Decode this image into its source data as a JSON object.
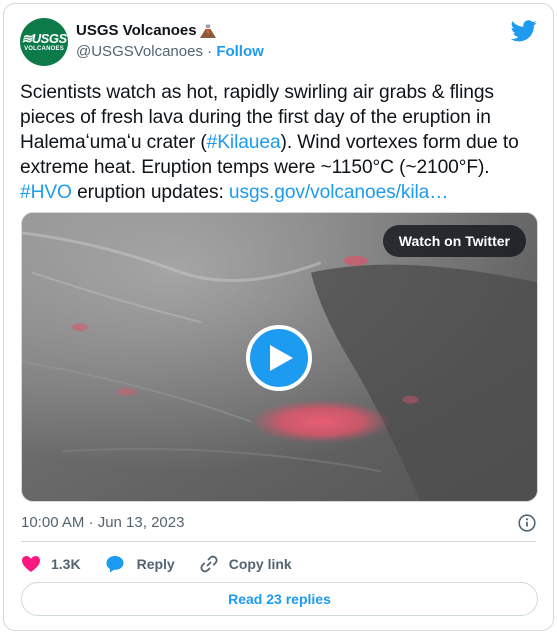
{
  "header": {
    "display_name": "USGS Volcanoes",
    "handle": "@USGSVolcanoes",
    "separator": "·",
    "follow_label": "Follow",
    "avatar": {
      "main": "≋USGS",
      "sub": "VOLCANOES",
      "color": "#0d7a4a"
    },
    "badge_icon": "volcano-emoji",
    "platform_icon": "twitter-bird-icon"
  },
  "tweet": {
    "text_1": "Scientists watch as hot, rapidly swirling air grabs & flings pieces of fresh lava during the first day of the eruption in Halemaʻumaʻu crater (",
    "hashtag_kilauea": "#Kilauea",
    "text_2": "). Wind vortexes form due to extreme heat. Eruption temps were ~1150°C (~2100°F). ",
    "hashtag_hvo": "#HVO",
    "text_3": " eruption updates: ",
    "url": "usgs.gov/volcanoes/kila…"
  },
  "media": {
    "watch_label": "Watch on Twitter",
    "play_icon": "play-icon"
  },
  "meta": {
    "timestamp": "10:00 AM · Jun 13, 2023"
  },
  "actions": {
    "likes": "1.3K",
    "reply_label": "Reply",
    "copy_label": "Copy link"
  },
  "footer": {
    "read_replies": "Read 23 replies"
  },
  "colors": {
    "accent": "#1d9bf0",
    "like": "#f91880",
    "text_secondary": "#536471",
    "border": "#cfd9de"
  }
}
